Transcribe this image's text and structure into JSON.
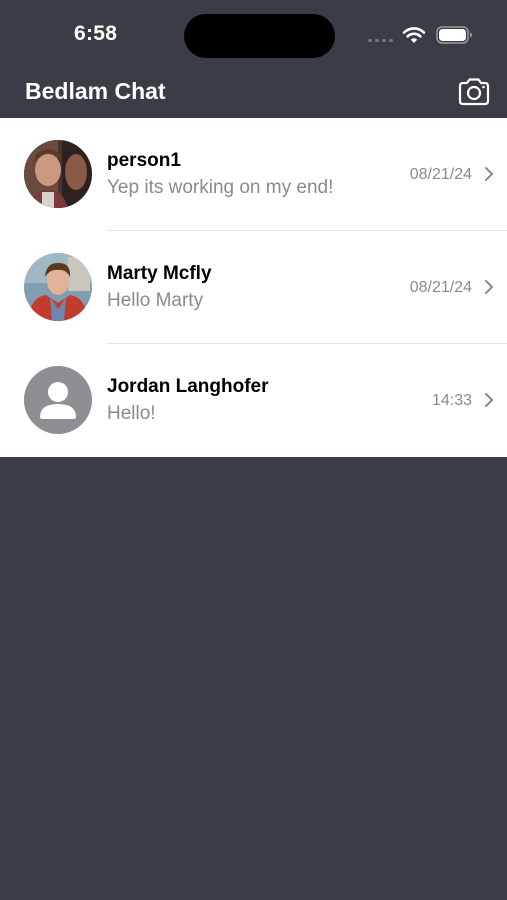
{
  "status_bar": {
    "time": "6:58"
  },
  "header": {
    "title": "Bedlam Chat",
    "camera_icon": "camera-icon"
  },
  "chats": [
    {
      "name": "person1",
      "preview": "Yep its working on my end!",
      "time": "08/21/24",
      "avatar": "photo"
    },
    {
      "name": "Marty Mcfly",
      "preview": "Hello Marty",
      "time": "08/21/24",
      "avatar": "photo"
    },
    {
      "name": "Jordan Langhofer",
      "preview": "Hello!",
      "time": "14:33",
      "avatar": "default-person-icon"
    }
  ],
  "colors": {
    "background": "#3a3d45",
    "list_background": "#ffffff",
    "secondary_text": "#8a8a8e"
  }
}
